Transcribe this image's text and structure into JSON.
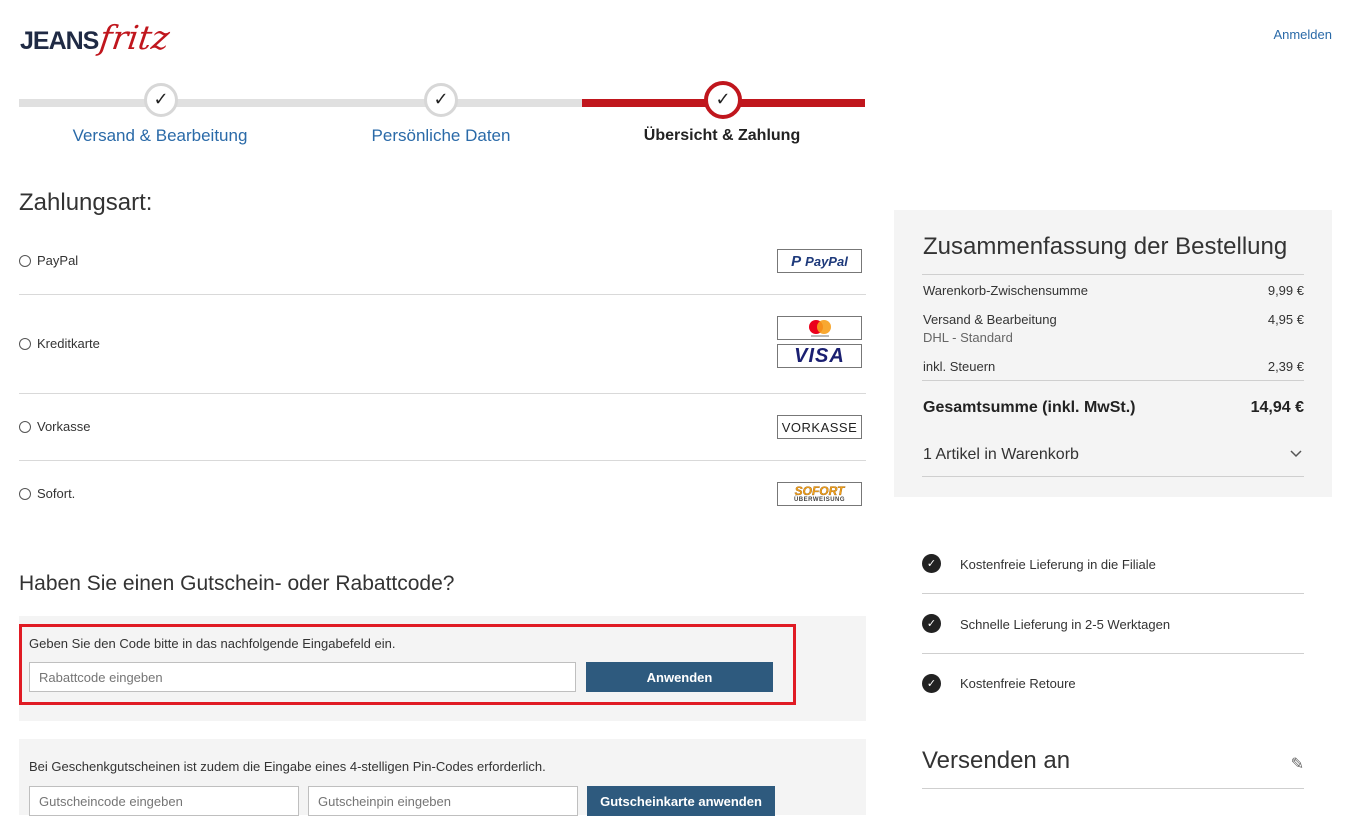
{
  "header": {
    "logo_jeans": "JEANS",
    "logo_fritz": "fritz",
    "login_label": "Anmelden"
  },
  "steps": [
    {
      "label": "Versand & Bearbeitung",
      "state": "done"
    },
    {
      "label": "Persönliche Daten",
      "state": "done"
    },
    {
      "label": "Übersicht & Zahlung",
      "state": "active"
    }
  ],
  "colors": {
    "accent_red": "#c0161d",
    "link_blue": "#2a6aa8",
    "button_blue": "#2e5a7e",
    "highlight_frame": "#e01b24",
    "panel_gray": "#f4f4f4"
  },
  "payment": {
    "title": "Zahlungsart:",
    "methods": [
      {
        "label": "PayPal",
        "logo": "PayPal",
        "icon": "paypal-logo"
      },
      {
        "label": "Kreditkarte",
        "logo": "VISA",
        "icon": "mastercard-visa-logo"
      },
      {
        "label": "Vorkasse",
        "logo": "VORKASSE",
        "icon": "vorkasse-badge"
      },
      {
        "label": "Sofort.",
        "logo_top": "SOFORT",
        "logo_bottom": "ÜBERWEISUNG",
        "icon": "sofort-logo"
      }
    ]
  },
  "voucher": {
    "title": "Haben Sie einen Gutschein- oder Rabattcode?",
    "hint": "Geben Sie den Code bitte in das nachfolgende Eingabefeld ein.",
    "code_placeholder": "Rabattcode eingeben",
    "apply_label": "Anwenden",
    "gift_hint": "Bei Geschenkgutscheinen ist zudem die Eingabe eines 4-stelligen Pin-Codes erforderlich.",
    "gift_code_placeholder": "Gutscheincode eingeben",
    "gift_pin_placeholder": "Gutscheinpin eingeben",
    "gift_apply_label": "Gutscheinkarte anwenden"
  },
  "summary": {
    "title": "Zusammenfassung der Bestellung",
    "subtotal_label": "Warenkorb-Zwischensumme",
    "subtotal_value": "9,99 €",
    "shipping_label": "Versand & Bearbeitung",
    "shipping_method": "DHL - Standard",
    "shipping_value": "4,95 €",
    "tax_label": "inkl. Steuern",
    "tax_value": "2,39 €",
    "total_label": "Gesamtsumme (inkl. MwSt.)",
    "total_value": "14,94 €",
    "cart_label": "1 Artikel in Warenkorb"
  },
  "benefits": [
    "Kostenfreie Lieferung in die Filiale",
    "Schnelle Lieferung in 2-5 Werktagen",
    "Kostenfreie Retoure"
  ],
  "shipping_address": {
    "title": "Versenden an"
  }
}
